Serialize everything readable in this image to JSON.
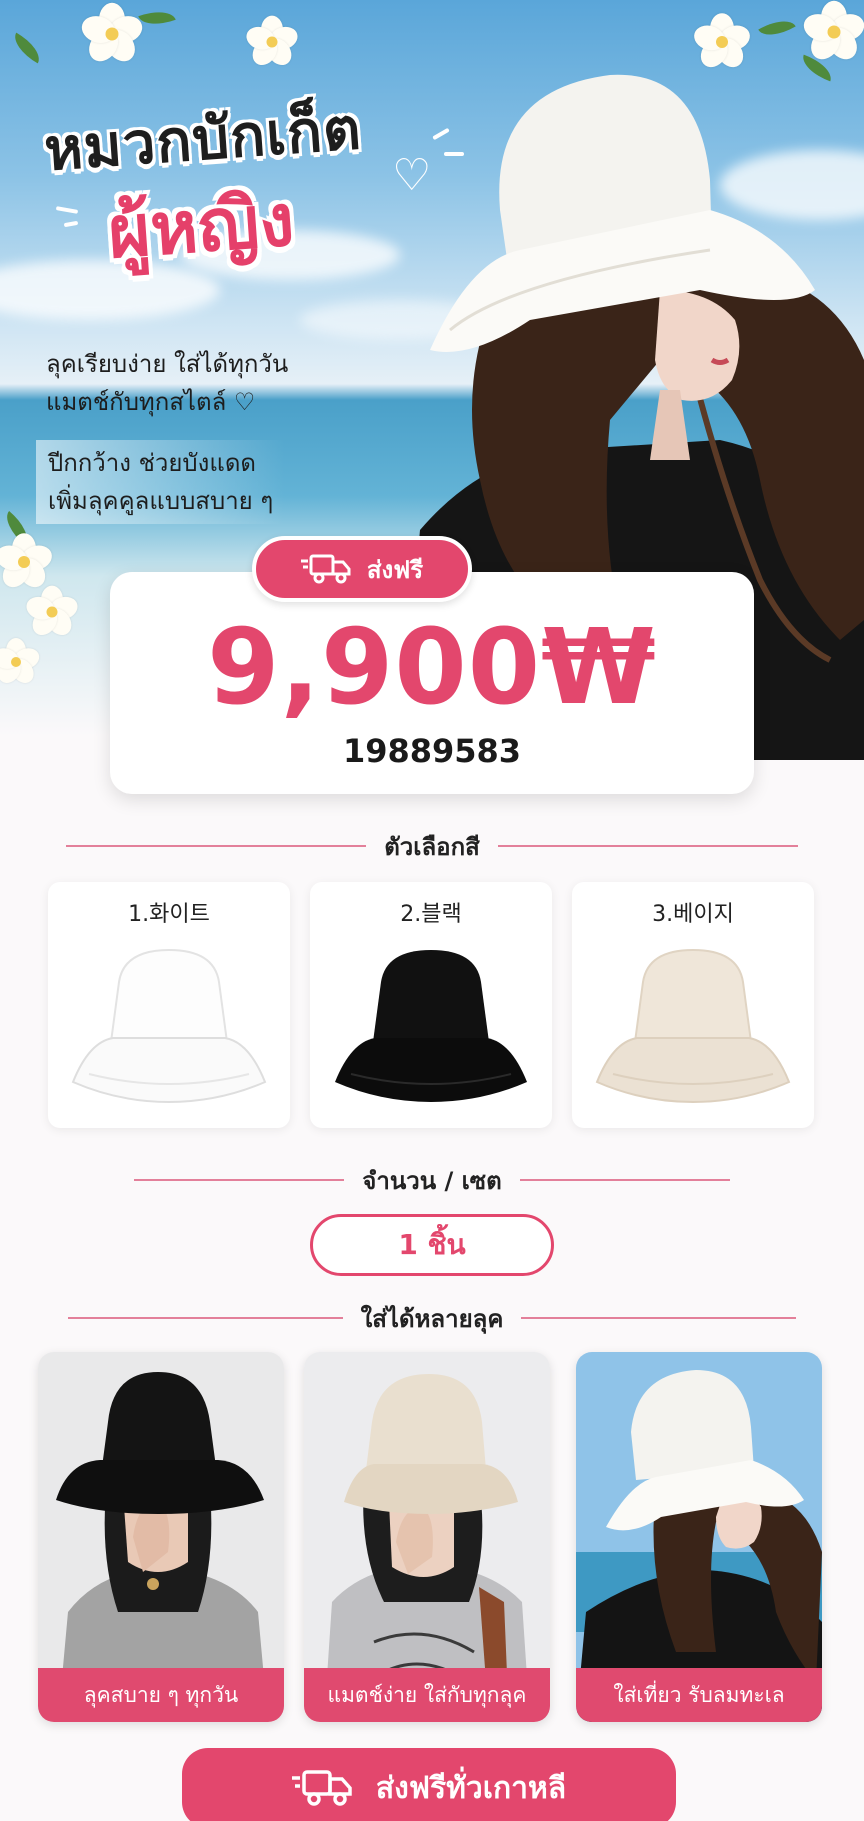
{
  "hero": {
    "title_line1": "หมวกบักเก็ต",
    "title_line2": "ผู้หญิง",
    "desc_line1": "ลุคเรียบง่าย ใส่ได้ทุกวัน",
    "desc_line2": "แมตช์กับทุกสไตล์ ♡",
    "desc_line3": "ปีกกว้าง ช่วยบังแดด",
    "desc_line4": "เพิ่มลุคคูลแบบสบาย ๆ"
  },
  "price_card": {
    "badge_icon": "truck-icon",
    "badge_label": "ส่งฟรี",
    "price": "9,900₩",
    "code": "19889583"
  },
  "colors_section": {
    "title": "ตัวเลือกสี",
    "options": [
      {
        "name": "1.화이트",
        "swatch": "#f7f7f7"
      },
      {
        "name": "2.블랙",
        "swatch": "#111111"
      },
      {
        "name": "3.베이지",
        "swatch": "#ece3d6"
      }
    ]
  },
  "quantity_section": {
    "title": "จำนวน / เซต",
    "value": "1 ชิ้น"
  },
  "styles_section": {
    "title": "ใส่ได้หลายลุค",
    "cards": [
      {
        "caption": "ลุคสบาย ๆ ทุกวัน"
      },
      {
        "caption": "แมตช์ง่าย ใส่กับทุกลุค"
      },
      {
        "caption": "ใส่เที่ยว รับลมทะเล"
      }
    ]
  },
  "bottom_button": {
    "icon": "truck-icon",
    "label": "ส่งฟรีทั่วเกาหลี"
  },
  "colors": {
    "accent": "#e3476d",
    "accent_line": "#e3809a"
  }
}
